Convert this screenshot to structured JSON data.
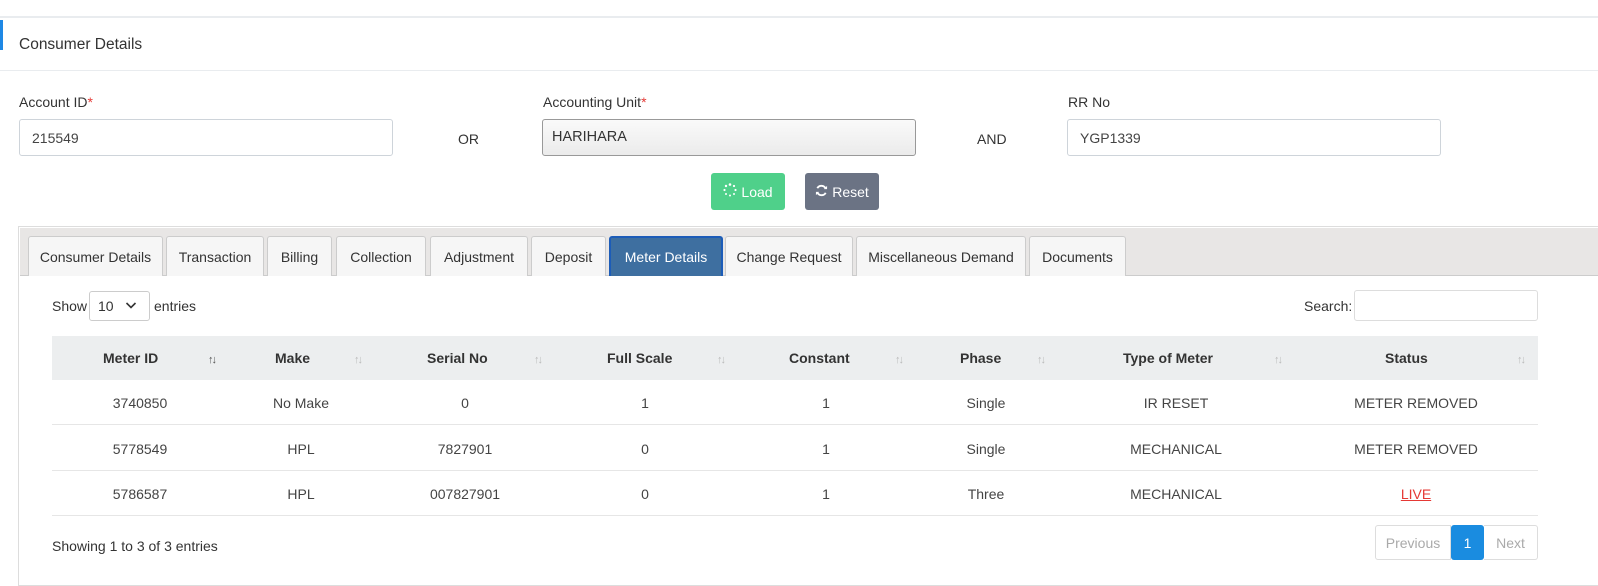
{
  "header": {
    "title": "Consumer Details"
  },
  "form": {
    "account_id_label": "Account ID",
    "account_id_value": "215549",
    "or_label": "OR",
    "accounting_unit_label": "Accounting Unit",
    "accounting_unit_value": "HARIHARA",
    "and_label": "AND",
    "rr_no_label": "RR No",
    "rr_no_value": "YGP1339",
    "required_mark": "*",
    "load_label": "Load",
    "reset_label": "Reset"
  },
  "tabs": [
    "Consumer Details",
    "Transaction",
    "Billing",
    "Collection",
    "Adjustment",
    "Deposit",
    "Meter Details",
    "Change Request",
    "Miscellaneous Demand",
    "Documents"
  ],
  "active_tab": "Meter Details",
  "table_controls": {
    "show_label": "Show",
    "entries_value": "10",
    "entries_label": "entries",
    "search_label": "Search:"
  },
  "table": {
    "columns": [
      "Meter ID",
      "Make",
      "Serial No",
      "Full Scale",
      "Constant",
      "Phase",
      "Type of Meter",
      "Status"
    ],
    "rows": [
      [
        "3740850",
        "No Make",
        "0",
        "1",
        "1",
        "Single",
        "IR RESET",
        "METER REMOVED"
      ],
      [
        "5778549",
        "HPL",
        "7827901",
        "0",
        "1",
        "Single",
        "MECHANICAL",
        "METER REMOVED"
      ],
      [
        "5786587",
        "HPL",
        "007827901",
        "0",
        "1",
        "Three",
        "MECHANICAL",
        "LIVE"
      ]
    ]
  },
  "footer": {
    "info": "Showing 1 to 3 of 3 entries",
    "previous": "Previous",
    "page": "1",
    "next": "Next"
  },
  "colors": {
    "load_button": "#4fd08a",
    "reset_button": "#6b7384",
    "active_tab": "#3e6fa0",
    "live_status": "#e53935",
    "pagination_active": "#1a8ce0"
  }
}
